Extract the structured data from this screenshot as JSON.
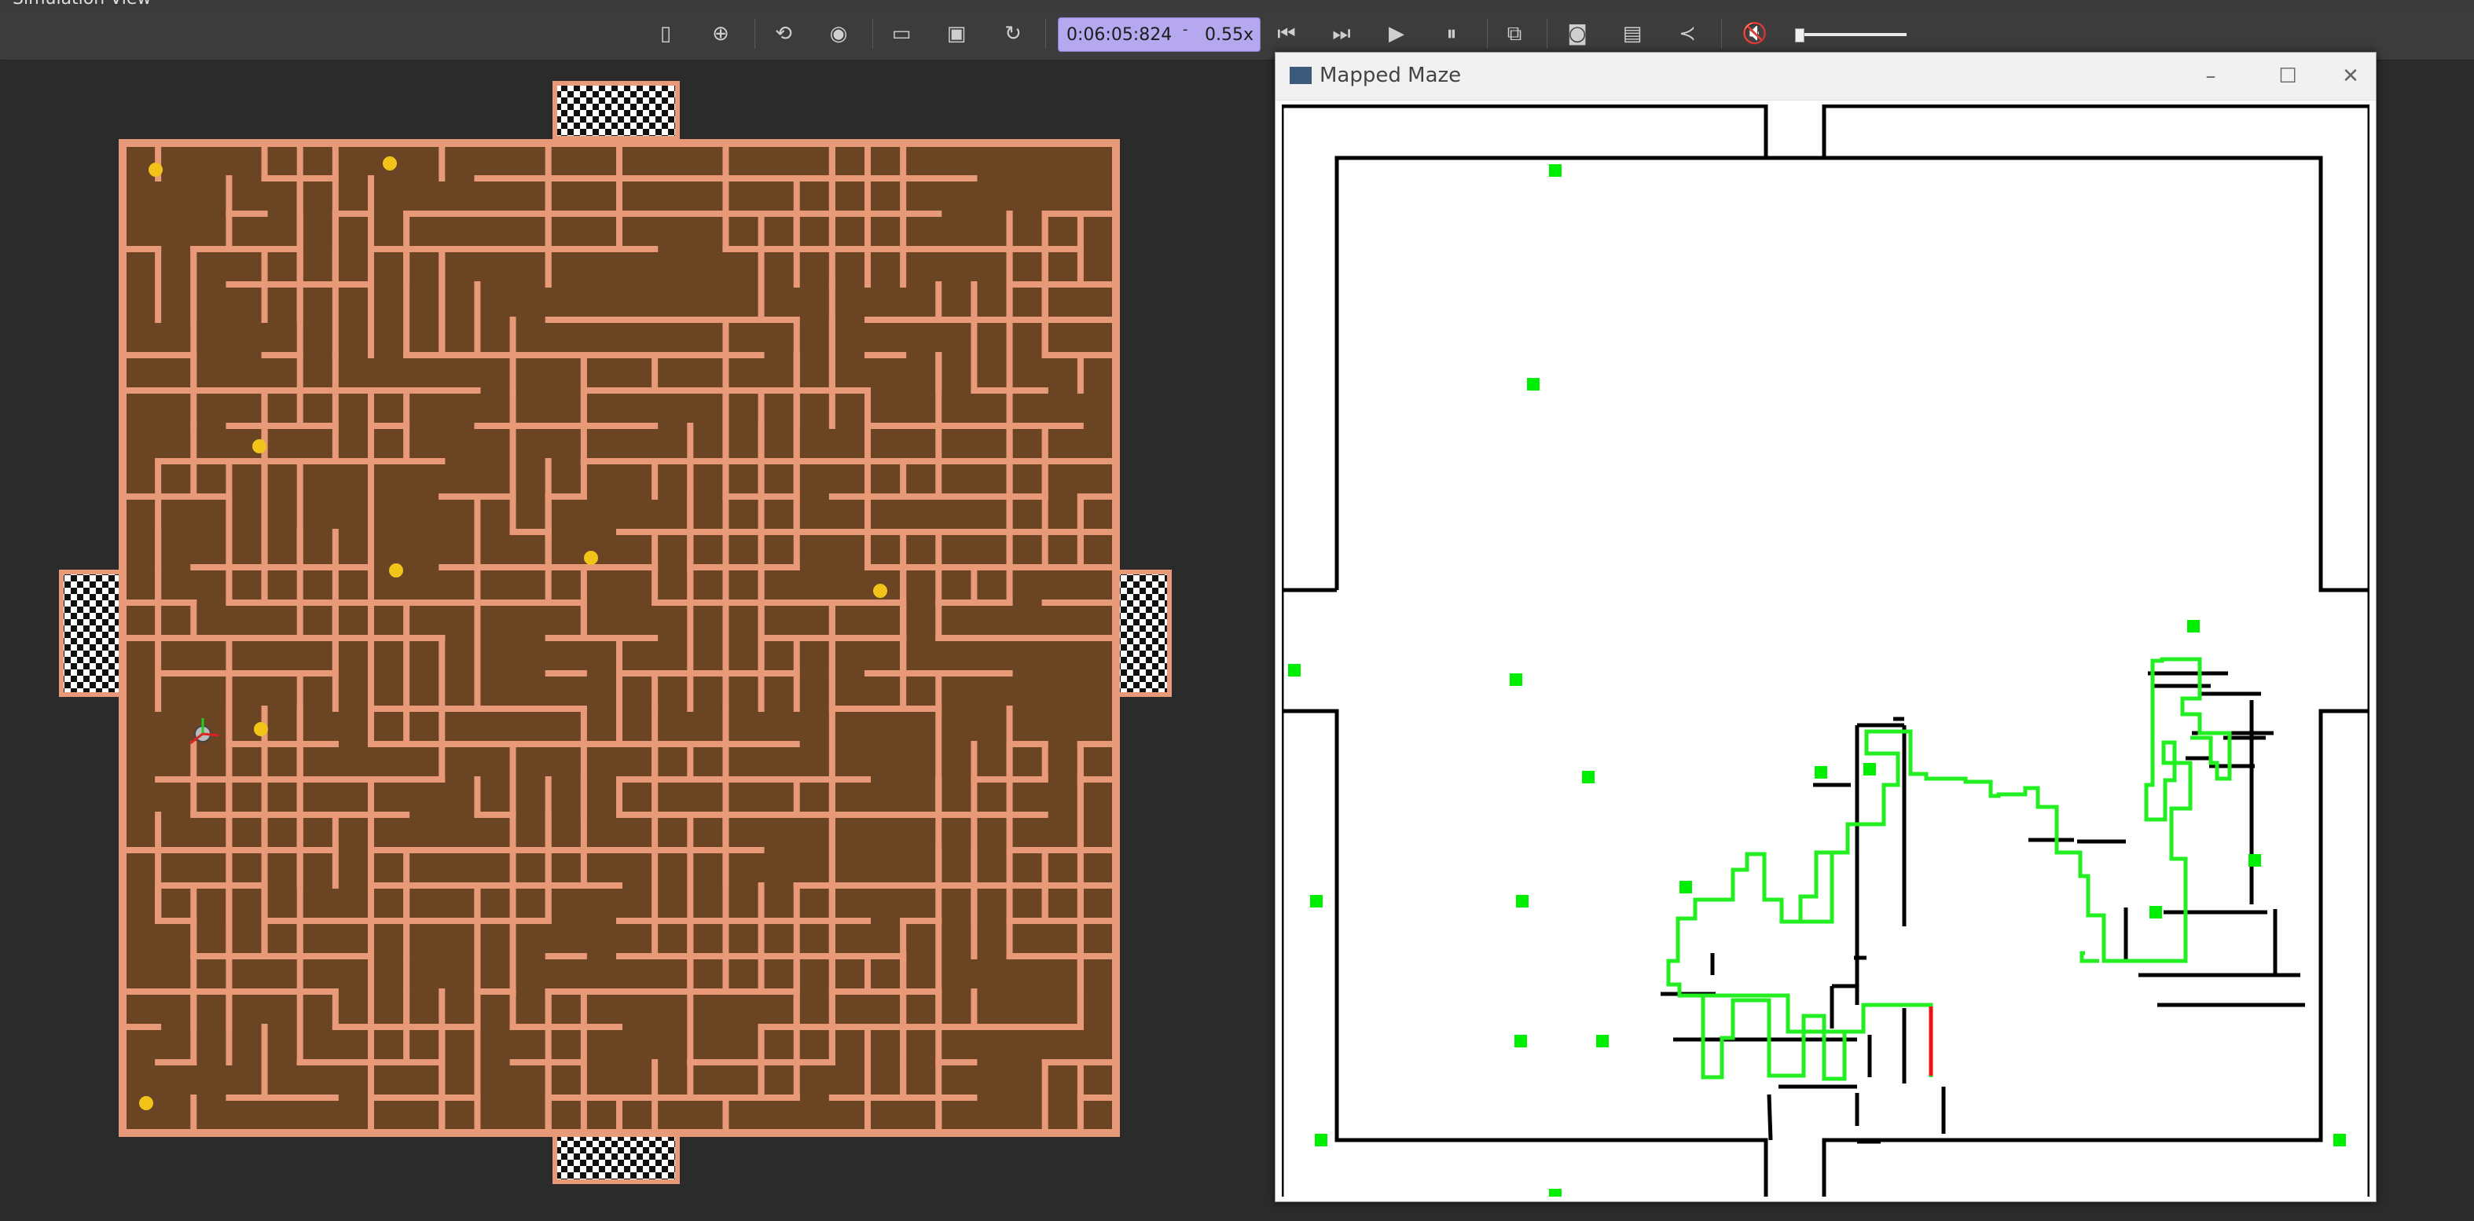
{
  "app": {
    "title": "Simulation View"
  },
  "toolbar": {
    "sim_time": "0:06:05:824",
    "speed": "0.55x",
    "speed_sep": "-",
    "icons": [
      "add-object-icon",
      "plus-circle-icon",
      "rotate-view-icon",
      "eye-icon",
      "open-folder-icon",
      "save-icon",
      "reload-icon",
      "step-back-icon",
      "step-forward-icon",
      "play-icon",
      "pause-icon",
      "view-3d-icon",
      "camera-icon",
      "film-icon",
      "share-icon",
      "mute-icon"
    ],
    "volume": 0.02
  },
  "maze_view": {
    "description": "3D maze simulation",
    "floor_color": "#6b4424",
    "wall_color": "#e89a78",
    "ball_color": "#f2c319"
  },
  "mapped_window": {
    "title": "Mapped Maze",
    "controls": [
      "minimize-icon",
      "maximize-icon",
      "close-icon"
    ],
    "trail_color": "#22ee22",
    "marker_color": "#00ee00",
    "robot_heading_color": "#ee1111"
  }
}
